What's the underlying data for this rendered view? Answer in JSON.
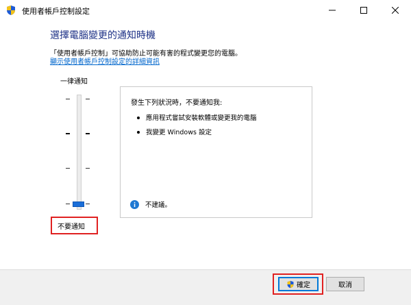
{
  "window": {
    "title": "使用者帳戶控制設定",
    "controls": [
      "minimize",
      "maximize",
      "close"
    ]
  },
  "header": {
    "heading": "選擇電腦變更的通知時機",
    "description": "「使用者帳戶控制」可協助防止可能有害的程式變更您的電腦。",
    "link": "顯示使用者帳戶控制設定的詳細資訊"
  },
  "slider": {
    "top_label": "一律通知",
    "bottom_label": "不要通知",
    "levels": 4,
    "selected_level": 1
  },
  "panel": {
    "title": "發生下列狀況時，不要通知我:",
    "items": [
      "應用程式嘗試安裝軟體或變更我的電腦",
      "我變更 Windows 設定"
    ],
    "info_text": "不建議。"
  },
  "footer": {
    "ok_label": "確定",
    "cancel_label": "取消"
  },
  "colors": {
    "heading": "#1e3287",
    "link": "#0066cc",
    "slider_thumb": "#1a6ed8",
    "highlight": "#e02020",
    "info_icon": "#1e78d2"
  },
  "icons": {
    "app": "uac-shield-icon",
    "ok_button": "uac-shield-icon",
    "info": "info-icon"
  }
}
